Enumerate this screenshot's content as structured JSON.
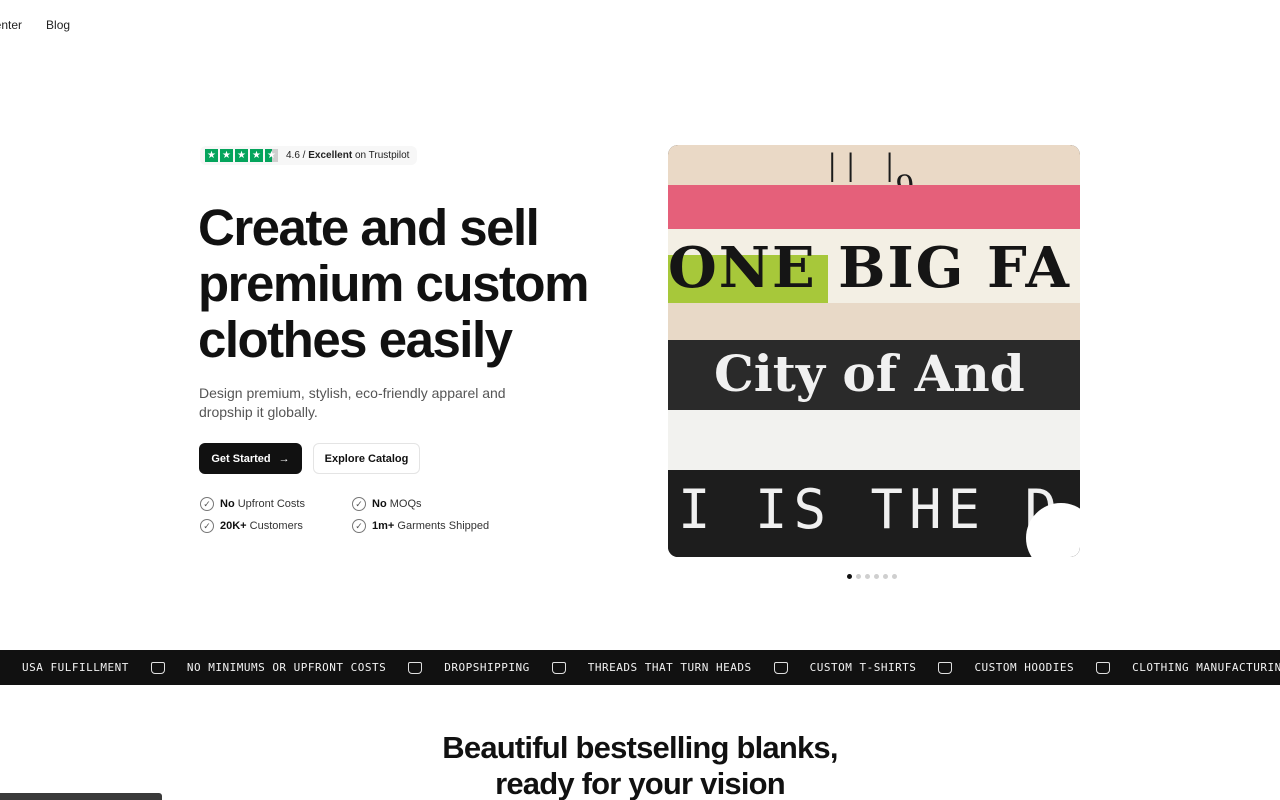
{
  "nav": {
    "items": [
      "Center",
      "Blog"
    ]
  },
  "hero": {
    "rating": {
      "stars": 4.6,
      "score": "4.6 /",
      "label": "Excellent",
      "suffix": "on Trustpilot"
    },
    "title_line1": "Create and sell",
    "title_line2": "premium custom",
    "title_line3": "clothes easily",
    "subtitle_line1": "Design premium, stylish, eco-friendly apparel and",
    "subtitle_line2": "dropship it globally.",
    "primary_button": "Get Started",
    "primary_arrow": "→",
    "secondary_button": "Explore Catalog",
    "features": [
      {
        "bold": "No",
        "text": "Upfront Costs"
      },
      {
        "bold": "No",
        "text": "MOQs"
      },
      {
        "bold": "20K+",
        "text": "Customers"
      },
      {
        "bold": "1m+",
        "text": "Garments Shipped"
      }
    ]
  },
  "image": {
    "print_top_digit": "9",
    "print_one_big": "ONE BIG FA",
    "print_city": "City of And",
    "print_bottom": "I IS THE D"
  },
  "carousel": {
    "total": 6,
    "active": 1
  },
  "marquee": {
    "items": [
      "USA FULFILLMENT",
      "NO MINIMUMS OR UPFRONT COSTS",
      "DROPSHIPPING",
      "THREADS THAT TURN HEADS",
      "CUSTOM T-SHIRTS",
      "CUSTOM HOODIES",
      "CLOTHING MANUFACTURING"
    ]
  },
  "section": {
    "title_line1": "Beautiful bestselling blanks,",
    "title_line2": "ready for your vision"
  },
  "colors": {
    "trustpilot_green": "#04a45c",
    "primary": "#111111",
    "marquee_bg": "#111111"
  }
}
